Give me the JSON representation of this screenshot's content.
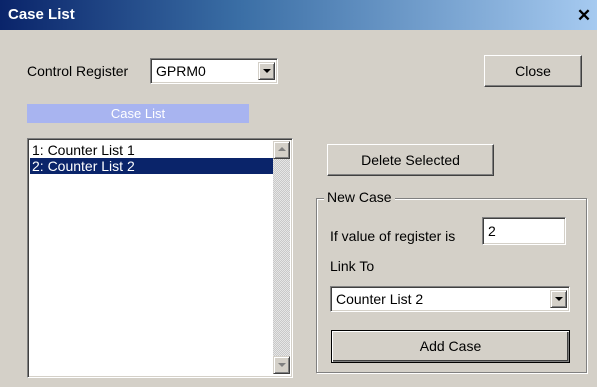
{
  "window": {
    "title": "Case List"
  },
  "control_register": {
    "label": "Control Register",
    "value": "GPRM0"
  },
  "close_button": {
    "label": "Close"
  },
  "case_list": {
    "header": "Case List",
    "items": [
      {
        "label": "1: Counter List 1",
        "selected": false
      },
      {
        "label": "2: Counter List 2",
        "selected": true
      }
    ]
  },
  "delete_button": {
    "label": "Delete Selected"
  },
  "new_case": {
    "group_label": "New Case",
    "value_label": "If value of register is",
    "value": "2",
    "link_label": "Link To",
    "link_value": "Counter List 2",
    "add_button": "Add Case"
  },
  "colors": {
    "selection": "#0a246a",
    "header_band": "#a8b4f0",
    "face": "#d4d0c8"
  }
}
